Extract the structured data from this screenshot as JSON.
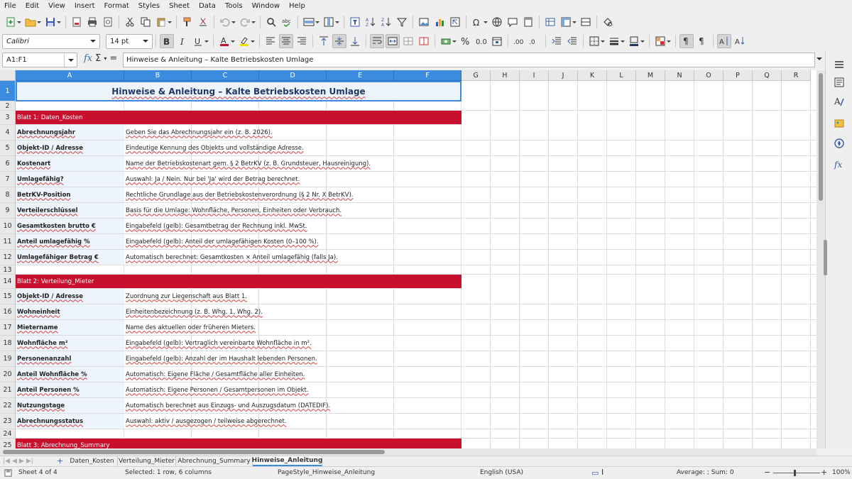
{
  "menu": [
    "File",
    "Edit",
    "View",
    "Insert",
    "Format",
    "Styles",
    "Sheet",
    "Data",
    "Tools",
    "Window",
    "Help"
  ],
  "font": {
    "name": "Calibri",
    "size": "14 pt"
  },
  "formula_bar": {
    "name_box": "A1:F1",
    "content": "Hinweise & Anleitung – Kalte Betriebskosten Umlage"
  },
  "columns": [
    "A",
    "B",
    "C",
    "D",
    "E",
    "F",
    "G",
    "H",
    "I",
    "J",
    "K",
    "L",
    "M",
    "N",
    "O",
    "P",
    "Q",
    "R"
  ],
  "rows": [
    "1",
    "2",
    "3",
    "4",
    "5",
    "6",
    "7",
    "8",
    "9",
    "10",
    "11",
    "12",
    "13",
    "14",
    "15",
    "16",
    "17",
    "18",
    "19",
    "20",
    "21",
    "22",
    "23",
    "24",
    "25"
  ],
  "title": "Hinweise & Anleitung – Kalte Betriebskosten Umlage",
  "sections": {
    "s1": "Blatt 1: Daten_Kosten",
    "s2": "Blatt 2: Verteilung_Mieter",
    "s3": "Blatt 3: Abrechnung_Summary"
  },
  "items1": [
    {
      "label": "Abrechnungsjahr",
      "desc": "Geben Sie das Abrechnungsjahr ein (z. B. 2026)."
    },
    {
      "label": "Objekt-ID / Adresse",
      "desc": "Eindeutige Kennung des Objekts und vollständige Adresse."
    },
    {
      "label": "Kostenart",
      "desc": "Name der Betriebskostenart gem. § 2 BetrKV (z. B. Grundsteuer, Hausreinigung)."
    },
    {
      "label": "Umlagefähig?",
      "desc": "Auswahl: Ja / Nein. Nur bei 'Ja' wird der Betrag berechnet."
    },
    {
      "label": "BetrKV-Position",
      "desc": "Rechtliche Grundlage aus der Betriebskostenverordnung (§ 2 Nr. X BetrKV)."
    },
    {
      "label": "Verteilerschlüssel",
      "desc": "Basis für die Umlage: Wohnfläche, Personen, Einheiten oder Verbrauch."
    },
    {
      "label": "Gesamtkosten brutto €",
      "desc": "Eingabefeld (gelb): Gesamtbetrag der Rechnung inkl. MwSt."
    },
    {
      "label": "Anteil umlagefähig %",
      "desc": "Eingabefeld (gelb): Anteil der umlagefähigen Kosten (0–100 %)."
    },
    {
      "label": "Umlagefähiger Betrag €",
      "desc": "Automatisch berechnet: Gesamtkosten × Anteil umlagefähig (falls Ja)."
    }
  ],
  "items2": [
    {
      "label": "Objekt-ID / Adresse",
      "desc": "Zuordnung zur Liegenschaft aus Blatt 1."
    },
    {
      "label": "Wohneinheit",
      "desc": "Einheitenbezeichnung (z. B. Whg. 1, Whg. 2)."
    },
    {
      "label": "Mietername",
      "desc": "Name des aktuellen oder früheren Mieters."
    },
    {
      "label": "Wohnfläche m²",
      "desc": "Eingabefeld (gelb): Vertraglich vereinbarte Wohnfläche in m²."
    },
    {
      "label": "Personenanzahl",
      "desc": "Eingabefeld (gelb): Anzahl der im Haushalt lebenden Personen."
    },
    {
      "label": "Anteil Wohnfläche %",
      "desc": "Automatisch: Eigene Fläche / Gesamtfläche aller Einheiten."
    },
    {
      "label": "Anteil Personen %",
      "desc": "Automatisch: Eigene Personen / Gesamtpersonen im Objekt."
    },
    {
      "label": "Nutzungstage",
      "desc": "Automatisch berechnet aus Einzugs- und Auszugsdatum (DATEDIF)."
    },
    {
      "label": "Abrechnungsstatus",
      "desc": "Auswahl: aktiv / ausgezogen / teilweise abgerechnet."
    }
  ],
  "tabs": [
    "Daten_Kosten",
    "Verteilung_Mieter",
    "Abrechnung_Summary",
    "Hinweise_Anleitung"
  ],
  "status": {
    "sheet": "Sheet 4 of 4",
    "selection": "Selected: 1 row, 6 columns",
    "page_style": "PageStyle_Hinweise_Anleitung",
    "language": "English (USA)",
    "summary": "Average: ; Sum: 0",
    "zoom": "100%"
  },
  "colors": {
    "section": "#c8102e",
    "selection": "#3b8be0",
    "title": "#1f3864"
  }
}
